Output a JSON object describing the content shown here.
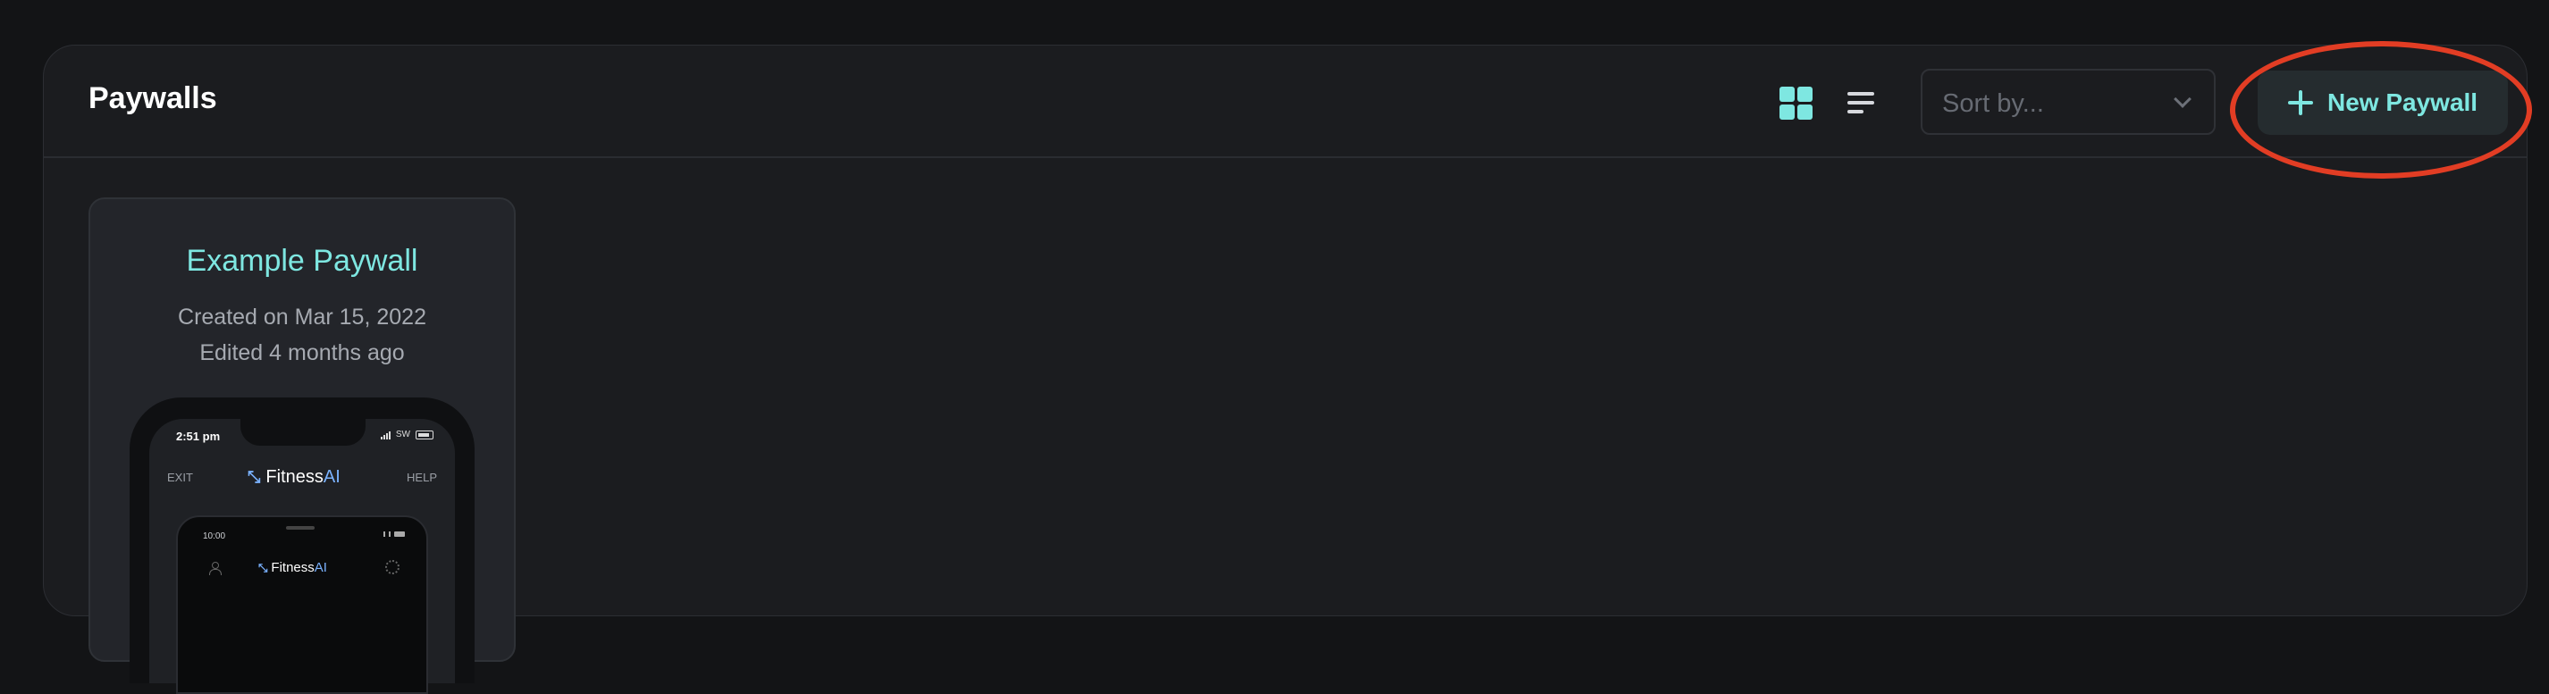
{
  "page": {
    "title": "Paywalls"
  },
  "toolbar": {
    "grid_view_icon": "grid-icon",
    "list_view_icon": "list-icon",
    "sort_placeholder": "Sort by...",
    "new_button_label": "New Paywall"
  },
  "colors": {
    "accent": "#7ee7e1",
    "highlight": "#e23d24",
    "background": "#1b1c1f"
  },
  "cards": [
    {
      "title": "Example Paywall",
      "created": "Created on Mar 15, 2022",
      "edited": "Edited 4 months ago",
      "preview": {
        "time": "2:51 pm",
        "carrier": "SW",
        "exit": "EXIT",
        "help": "HELP",
        "brand_name": "Fitness",
        "brand_suffix": "AI",
        "inner_time": "10:00",
        "inner_brand_name": "Fitness",
        "inner_brand_suffix": "AI"
      }
    }
  ]
}
